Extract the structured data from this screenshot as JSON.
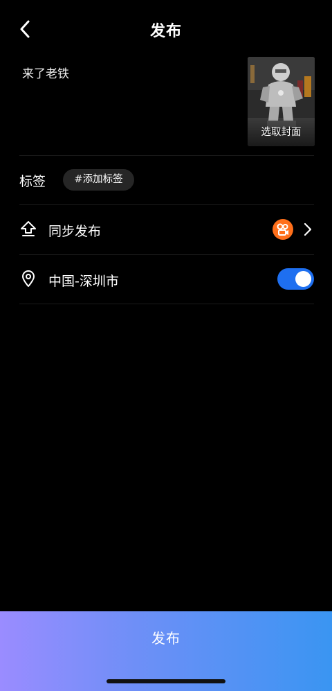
{
  "header": {
    "title": "发布",
    "back_icon": "chevron-left-icon"
  },
  "post": {
    "caption": "来了老铁",
    "cover_label": "选取封面"
  },
  "tags": {
    "label": "标签",
    "add_chip": "#添加标签"
  },
  "sync": {
    "label": "同步发布",
    "icon": "share-up-icon",
    "platform_icon": "kuaishou-icon"
  },
  "location": {
    "label": "中国-深圳市",
    "icon": "location-pin-icon",
    "toggle_on": true
  },
  "footer": {
    "publish_label": "发布"
  },
  "colors": {
    "background": "#000000",
    "toggle": "#1e6ff0",
    "platform": "#ff6f1a",
    "publish_gradient_start": "#9a8cff",
    "publish_gradient_end": "#3a95f2"
  }
}
